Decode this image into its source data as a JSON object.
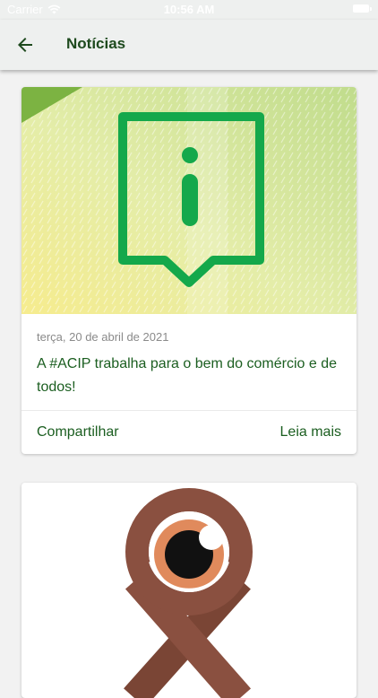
{
  "status_bar": {
    "carrier": "Carrier",
    "time": "10:56 AM"
  },
  "header": {
    "title": "Notícias",
    "back_icon": "arrow-left-icon"
  },
  "news": [
    {
      "date": "terça, 20 de abril de 2021",
      "headline": "A #ACIP trabalha para o bem do comércio e de todos!",
      "share_label": "Compartilhar",
      "read_more_label": "Leia mais",
      "image_icon": "info-speech-bubble-icon"
    },
    {
      "image_icon": "awareness-ribbon-eye-icon"
    }
  ],
  "colors": {
    "accent_green": "#1b5e20",
    "info_green": "#14a84b",
    "ribbon_brown": "#8a5040",
    "iris_orange": "#e08a5c"
  }
}
